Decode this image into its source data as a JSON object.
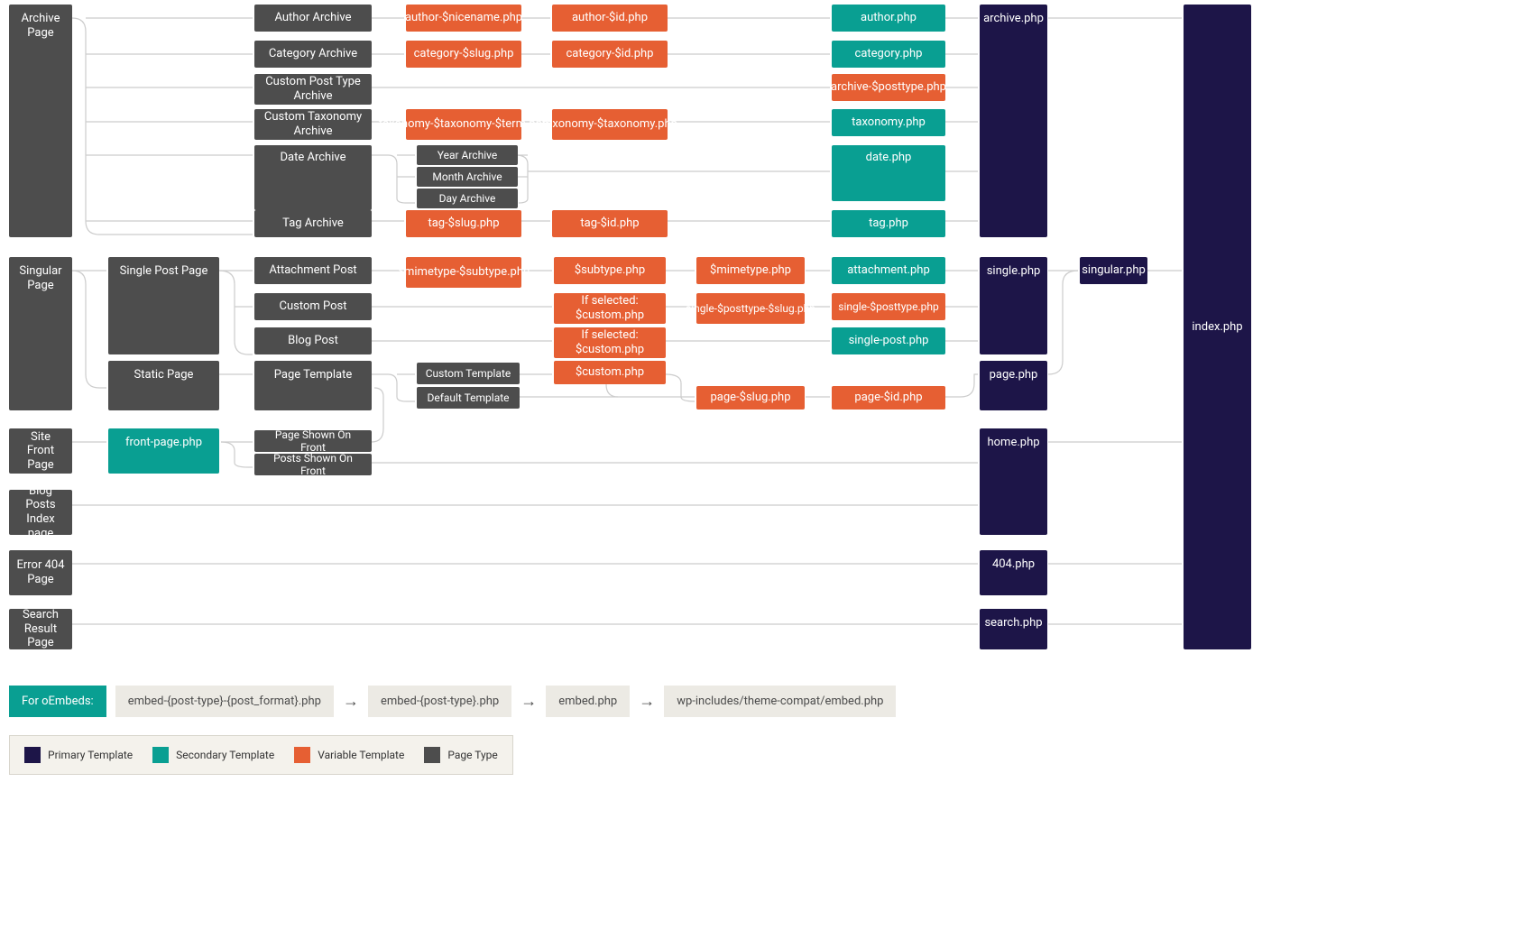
{
  "colors": {
    "page_type": "#4d4d4d",
    "primary": "#1d1548",
    "secondary": "#099f92",
    "variable": "#e65f33"
  },
  "nodes": {
    "archive_page": "Archive Page",
    "author_archive": "Author Archive",
    "author_nicename": "author-$nicename.php",
    "author_id": "author-$id.php",
    "author_php": "author.php",
    "category_archive": "Category Archive",
    "category_slug": "category-$slug.php",
    "category_id": "category-$id.php",
    "category_php": "category.php",
    "cpt_archive": "Custom Post Type Archive",
    "archive_posttype": "archive-$posttype.php",
    "ct_archive": "Custom Taxonomy Archive",
    "taxonomy_term": "taxonomy-$taxonomy-$term.php",
    "taxonomy_tax": "taxonomy-$taxonomy.php",
    "taxonomy_php": "taxonomy.php",
    "date_archive": "Date Archive",
    "year_archive": "Year Archive",
    "month_archive": "Month Archive",
    "day_archive": "Day Archive",
    "date_php": "date.php",
    "tag_archive": "Tag Archive",
    "tag_slug": "tag-$slug.php",
    "tag_id": "tag-$id.php",
    "tag_php": "tag.php",
    "archive_php": "archive.php",
    "index_php": "index.php",
    "singular_page": "Singular Page",
    "single_post_page": "Single Post Page",
    "attachment_post": "Attachment Post",
    "mimetype_subtype": "$mimetype-$subtype.php",
    "subtype": "$subtype.php",
    "mimetype": "$mimetype.php",
    "attachment_php": "attachment.php",
    "custom_post": "Custom Post",
    "if_selected_custom_1": "If selected: $custom.php",
    "single_posttype_slug": "single-$posttype-$slug.php",
    "single_posttype": "single-$posttype.php",
    "blog_post": "Blog Post",
    "if_selected_custom_2": "If selected: $custom.php",
    "single_post_php": "single-post.php",
    "single_php": "single.php",
    "singular_php": "singular.php",
    "static_page": "Static Page",
    "page_template": "Page Template",
    "custom_template": "Custom Template",
    "default_template": "Default Template",
    "custom_php": "$custom.php",
    "page_slug": "page-$slug.php",
    "page_id": "page-$id.php",
    "page_php": "page.php",
    "site_front_page": "Site Front Page",
    "front_page_php": "front-page.php",
    "page_shown_front": "Page Shown On Front",
    "posts_shown_front": "Posts Shown On Front",
    "home_php": "home.php",
    "blog_posts_index": "Blog Posts Index page",
    "error_404": "Error 404 Page",
    "404_php": "404.php",
    "search_result": "Search Result Page",
    "search_php": "search.php"
  },
  "oembed": {
    "label": "For oEmbeds:",
    "steps": [
      "embed-{post-type}-{post_format}.php",
      "embed-{post-type}.php",
      "embed.php",
      "wp-includes/theme-compat/embed.php"
    ]
  },
  "legend": {
    "primary": "Primary Template",
    "secondary": "Secondary Template",
    "variable": "Variable Template",
    "page_type": "Page Type"
  }
}
